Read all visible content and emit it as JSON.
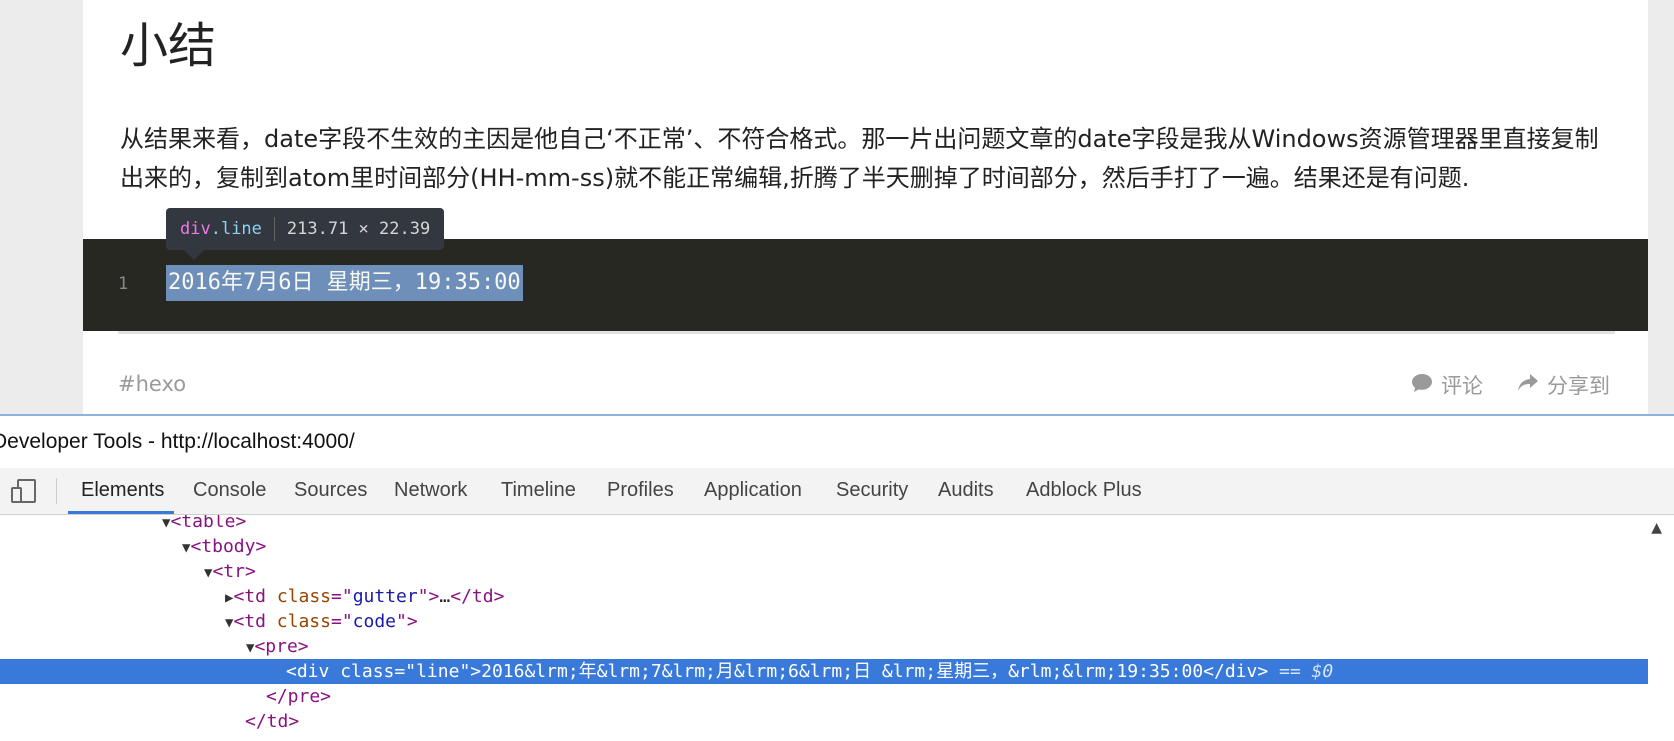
{
  "article": {
    "title": "小结",
    "paragraph": "从结果来看，date字段不生效的主因是他自己‘不正常’、不符合格式。那一片出问题文章的date字段是我从Windows资源管理器里直接复制出来的，复制到atom里时间部分(HH-mm-ss)就不能正常编辑,折腾了半天删掉了时间部分，然后手打了一遍。结果还是有问题.",
    "code_line_number": "1",
    "code_line": "2016年7月6日 星期三，19:35:00",
    "tag": "#hexo",
    "comment_label": "评论",
    "share_label": "分享到"
  },
  "tooltip": {
    "tag": "div",
    "class": ".line",
    "size": "213.71 × 22.39"
  },
  "devtools": {
    "title": "Developer Tools - http://localhost:4000/",
    "tabs": [
      "Elements",
      "Console",
      "Sources",
      "Network",
      "Timeline",
      "Profiles",
      "Application",
      "Security",
      "Audits",
      "Adblock Plus"
    ],
    "active_tab": "Elements",
    "tree": {
      "table": "table",
      "tbody": "tbody",
      "tr": "tr",
      "td_gutter_tag": "td",
      "td_gutter_attr": "class",
      "td_gutter_val": "gutter",
      "ellipsis": "…",
      "td_code_val": "code",
      "pre": "pre",
      "div_tag": "div",
      "div_attr": "class",
      "div_val": "line",
      "div_text": "2016&lrm;年&lrm;7&lrm;月&lrm;6&lrm;日 &lrm;星期三，&rlm;&lrm;19:35:00",
      "selected_marker": "== $0"
    }
  },
  "colors": {
    "code_bg": "#272822",
    "selection": "#6d8fb9",
    "devtools_selected_row": "#3879d9",
    "tab_underline": "#3879d9"
  }
}
